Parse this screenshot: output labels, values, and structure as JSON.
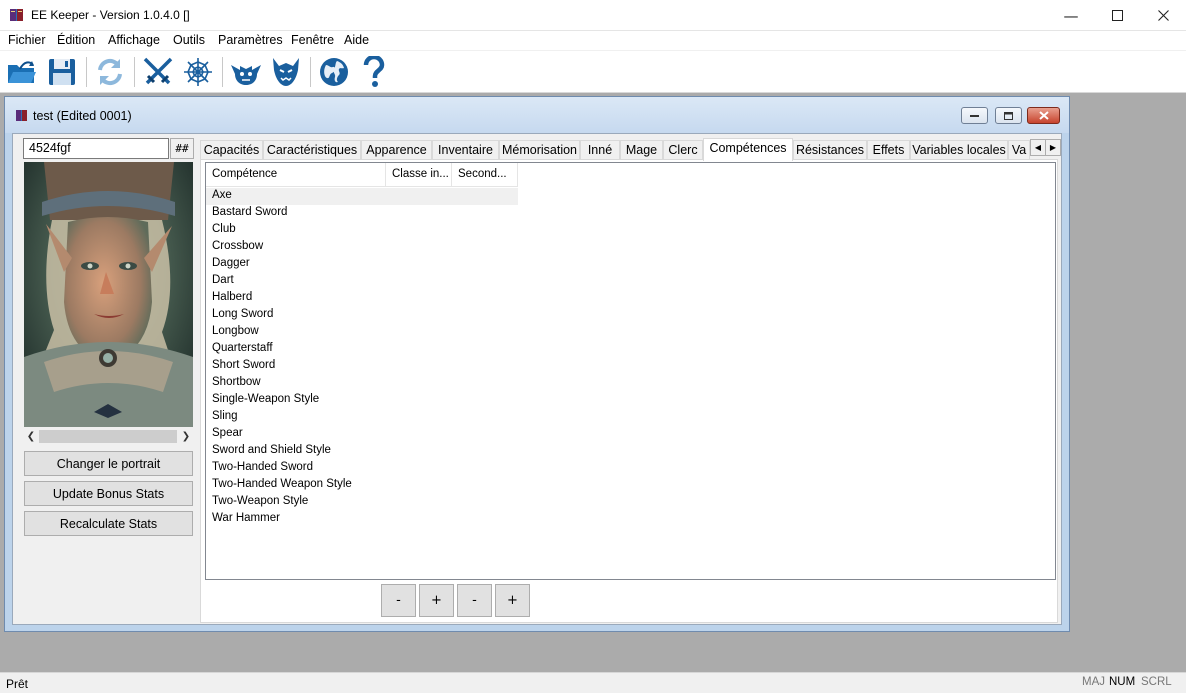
{
  "window": {
    "title": "EE Keeper - Version 1.0.4.0 []"
  },
  "menu": [
    "Fichier",
    "Édition",
    "Affichage",
    "Outils",
    "Paramètres",
    "Fenêtre",
    "Aide"
  ],
  "toolbar_icons": [
    "open-folder-icon",
    "save-disk-icon",
    "refresh-icon",
    "crossed-swords-icon",
    "spider-web-icon",
    "goblin-face-icon",
    "demon-face-icon",
    "globe-icon",
    "help-question-icon"
  ],
  "child": {
    "title": "test (Edited 0001)"
  },
  "character": {
    "name_value": "4524fgf",
    "hash_label": "##"
  },
  "side_buttons": [
    "Changer le portrait",
    "Update Bonus Stats",
    "Recalculate Stats"
  ],
  "tabs": [
    "Capacités",
    "Caractéristiques",
    "Apparence",
    "Inventaire",
    "Mémorisation",
    "Inné",
    "Mage",
    "Clerc",
    "Compétences",
    "Résistances",
    "Effets",
    "Variables locales",
    "Va"
  ],
  "active_tab": "Compétences",
  "columns": [
    "Compétence",
    "Classe in...",
    "Second..."
  ],
  "skills": [
    "Axe",
    "Bastard Sword",
    "Club",
    "Crossbow",
    "Dagger",
    "Dart",
    "Halberd",
    "Long Sword",
    "Longbow",
    "Quarterstaff",
    "Short Sword",
    "Shortbow",
    "Single-Weapon Style",
    "Sling",
    "Spear",
    "Sword and Shield Style",
    "Two-Handed Sword",
    "Two-Handed Weapon Style",
    "Two-Weapon Style",
    "War Hammer"
  ],
  "pm_buttons": [
    "-",
    "+",
    "-",
    "+"
  ],
  "status": {
    "text": "Prêt",
    "indicators": [
      "MAJ",
      "NUM",
      "SCRL"
    ]
  },
  "colors": {
    "child_title": "#c6d9ef",
    "close_button": "#c7432d",
    "accent_blue": "#1f6fb8"
  }
}
